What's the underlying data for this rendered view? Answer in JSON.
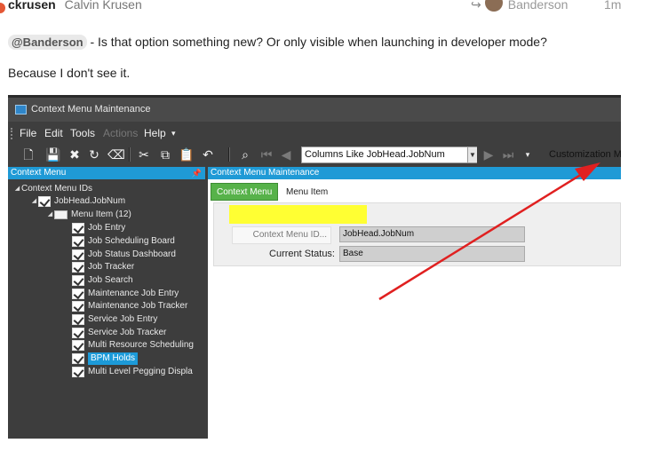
{
  "post": {
    "username": "ckrusen",
    "full_name": "Calvin Krusen",
    "reply_to": "Banderson",
    "age": "1m",
    "mention": "@Banderson",
    "text_line1": " - Is that option something new? Or only visible when launching in developer mode?",
    "text_line2": "Because I don't see it."
  },
  "app": {
    "window_title": "Context Menu Maintenance",
    "menu": [
      "File",
      "Edit",
      "Tools",
      "Actions",
      "Help"
    ],
    "search_value": "Columns Like JobHead.JobNum",
    "customization_label": "Customization M",
    "left_panel_title": "Context Menu",
    "tree": {
      "root": "Context Menu IDs",
      "job_head": "JobHead.JobNum",
      "menu_item_group": "Menu Item (12)",
      "items": [
        "Job Entry",
        "Job Scheduling Board",
        "Job Status Dashboard",
        "Job Tracker",
        "Job Search",
        "Maintenance Job Entry",
        "Maintenance Job Tracker",
        "Service Job Entry",
        "Service Job Tracker",
        "Multi Resource Scheduling",
        "BPM Holds",
        "Multi Level Pegging Displa"
      ],
      "selected": "BPM Holds"
    },
    "right_panel_title": "Context Menu Maintenance",
    "tabs": [
      "Context Menu",
      "Menu Item"
    ],
    "fields": {
      "context_menu_id_label": "Context Menu ID...",
      "context_menu_id_value": "JobHead.JobNum",
      "current_status_label": "Current Status:",
      "current_status_value": "Base"
    }
  },
  "colors": {
    "accent_blue": "#1f9ad6",
    "tab_green": "#57b24a",
    "highlight_yellow": "#ffff33",
    "arrow_red": "#e02020"
  }
}
